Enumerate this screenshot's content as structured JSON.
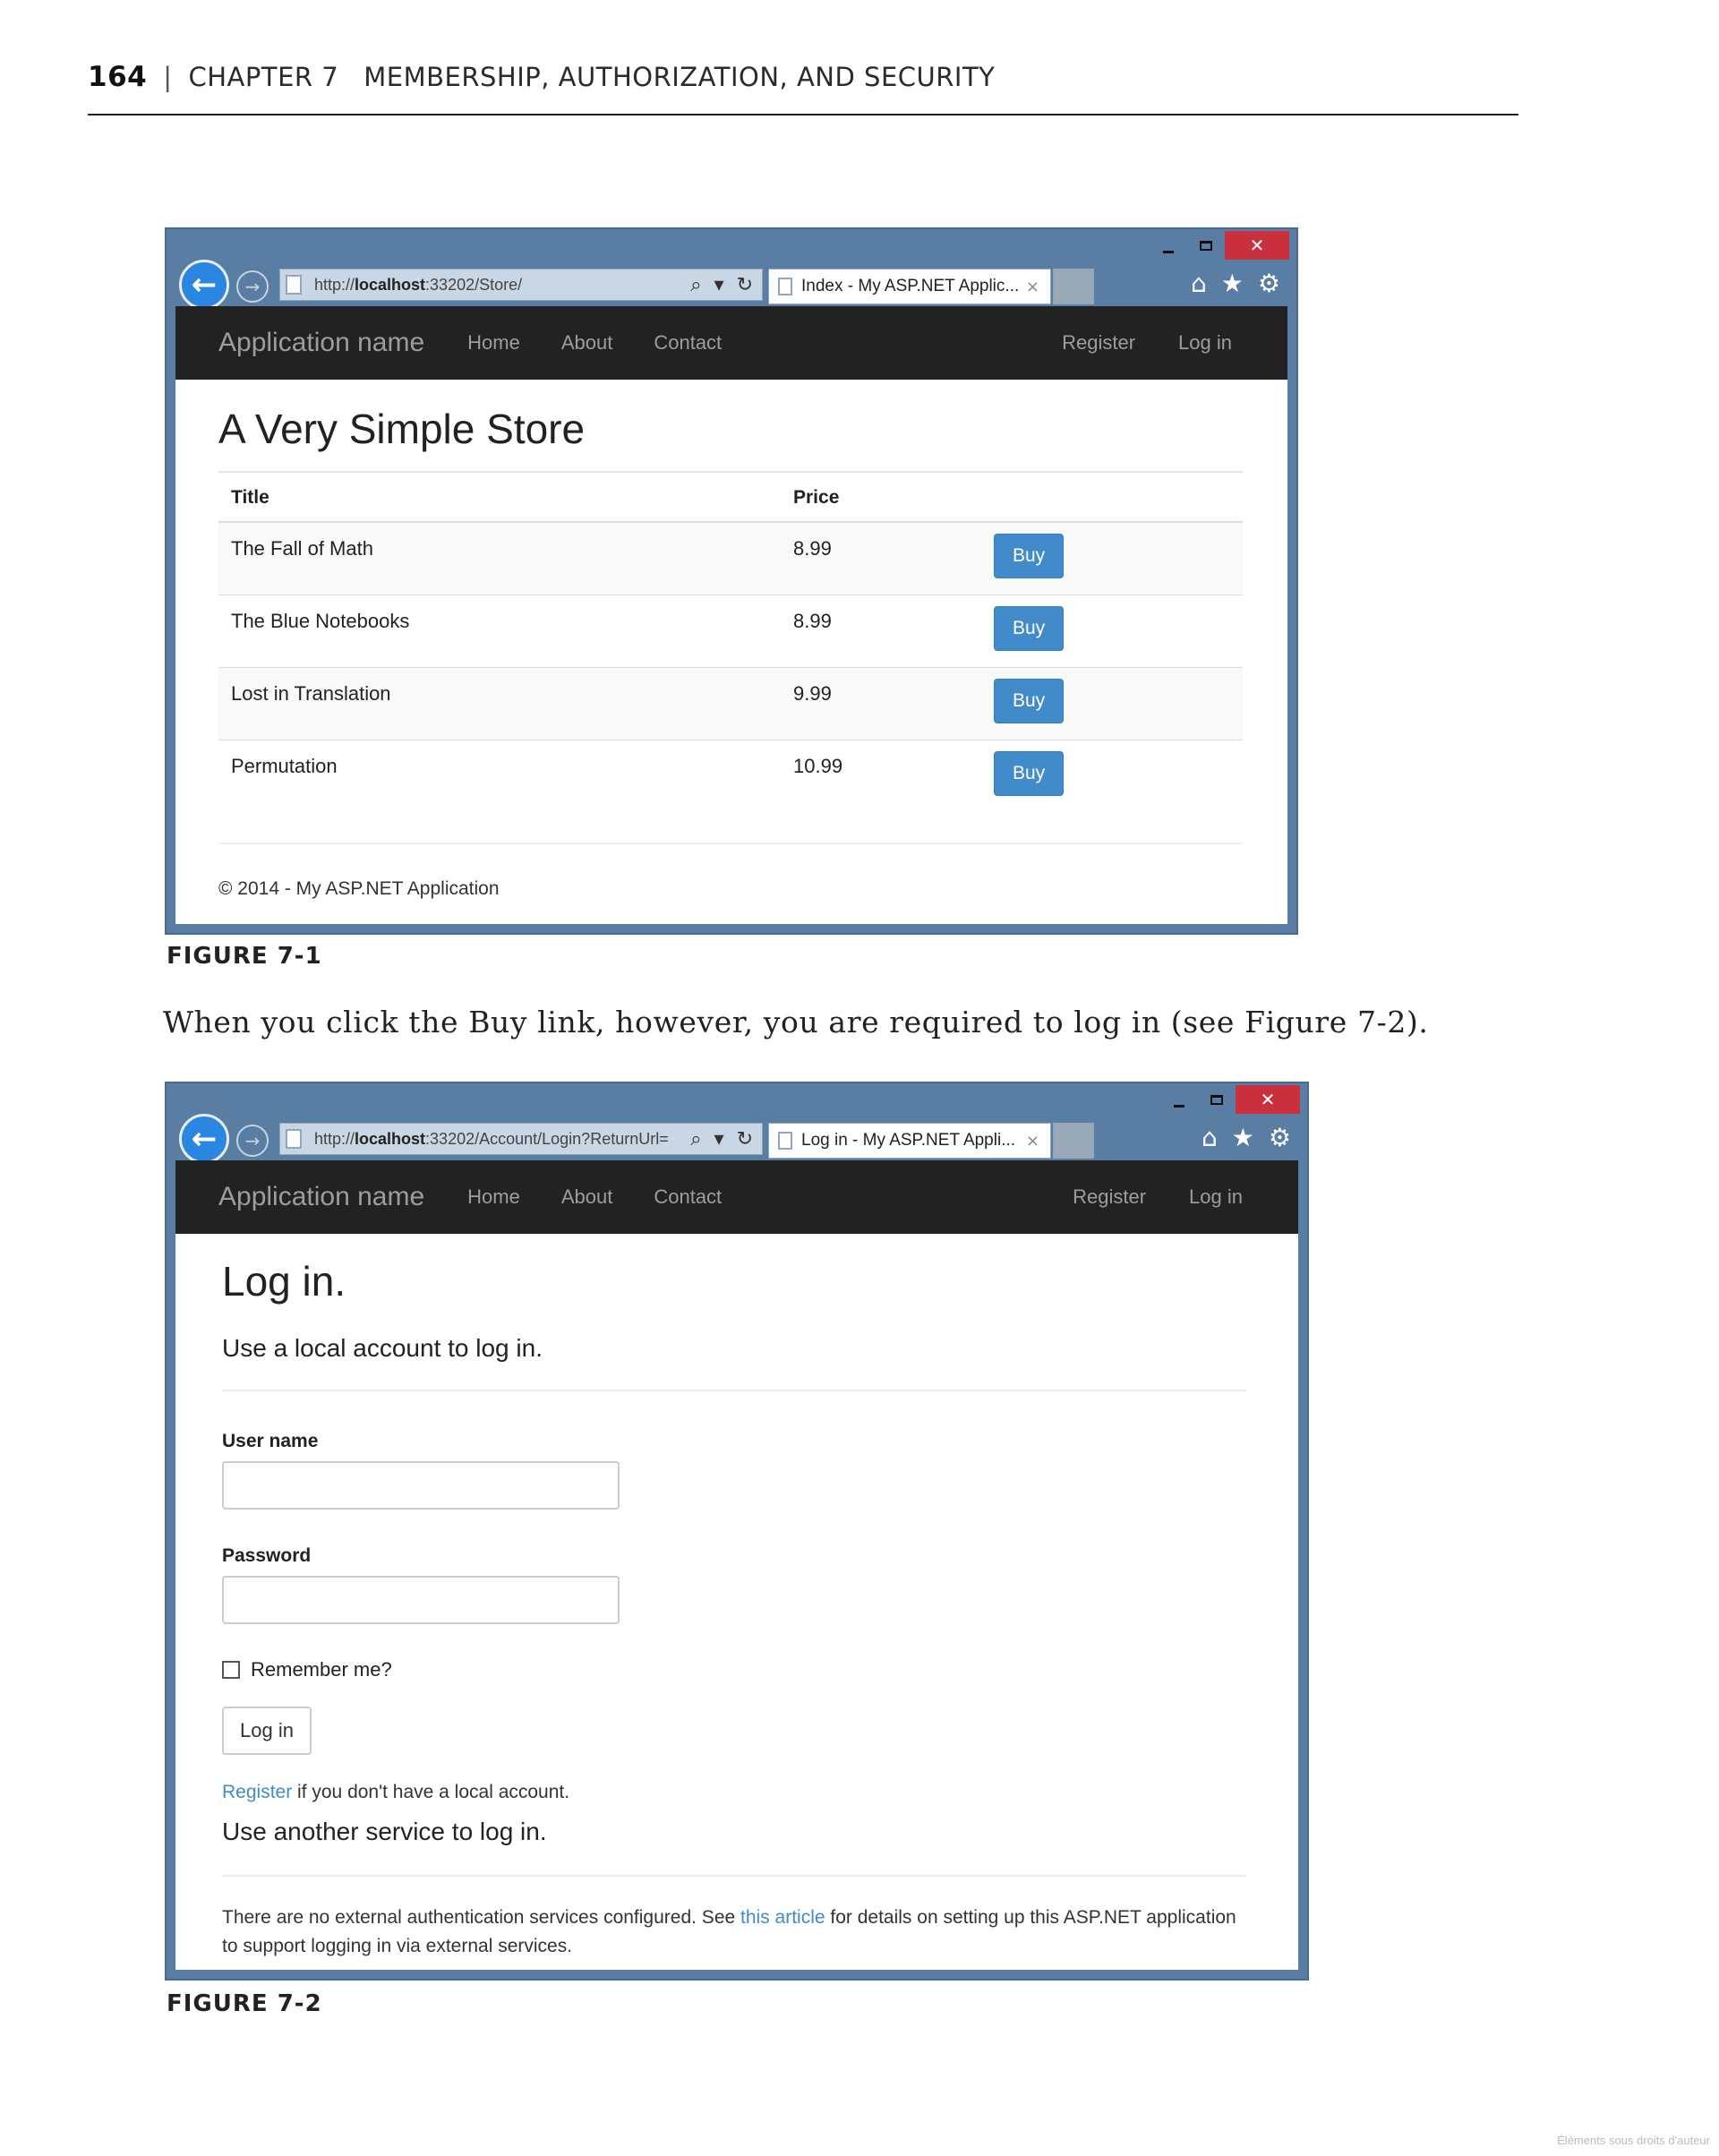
{
  "page_header": {
    "page_number": "164",
    "separator": "|",
    "chapter_label": "CHAPTER 7",
    "chapter_title": "MEMBERSHIP, AUTHORIZATION, AND SECURITY"
  },
  "figure1": {
    "browser": {
      "url_prefix": "http://",
      "url_host": "localhost",
      "url_rest": ":33202/Store/",
      "tab_title": "Index - My ASP.NET Applic...",
      "close_glyph": "×"
    },
    "navbar": {
      "brand": "Application name",
      "links": [
        "Home",
        "About",
        "Contact"
      ],
      "right_links": [
        "Register",
        "Log in"
      ]
    },
    "title": "A Very Simple Store",
    "table": {
      "headers": [
        "Title",
        "Price"
      ],
      "rows": [
        {
          "title": "The Fall of Math",
          "price": "8.99",
          "action": "Buy"
        },
        {
          "title": "The Blue Notebooks",
          "price": "8.99",
          "action": "Buy"
        },
        {
          "title": "Lost in Translation",
          "price": "9.99",
          "action": "Buy"
        },
        {
          "title": "Permutation",
          "price": "10.99",
          "action": "Buy"
        }
      ]
    },
    "footer": "© 2014 - My ASP.NET Application",
    "caption": "FIGURE 7-1"
  },
  "body_text": "When you click the Buy link, however, you are required to log in (see Figure 7-2).",
  "figure2": {
    "browser": {
      "url_prefix": "http://",
      "url_host": "localhost",
      "url_rest": ":33202/Account/Login?ReturnUrl=",
      "tab_title": "Log in - My ASP.NET Appli...",
      "close_glyph": "×"
    },
    "navbar": {
      "brand": "Application name",
      "links": [
        "Home",
        "About",
        "Contact"
      ],
      "right_links": [
        "Register",
        "Log in"
      ]
    },
    "title": "Log in.",
    "subtitle": "Use a local account to log in.",
    "username_label": "User name",
    "username_value": "",
    "password_label": "Password",
    "password_value": "",
    "remember_label": "Remember me?",
    "login_button": "Log in",
    "register_link": "Register",
    "register_suffix": " if you don't have a local account.",
    "other_service_heading": "Use another service to log in.",
    "ext_note_before": "There are no external authentication services configured. See ",
    "ext_note_link": "this article",
    "ext_note_after": " for details on setting up this ASP.NET application to support logging in via external services.",
    "caption": "FIGURE 7-2"
  },
  "icons": {
    "back": "back-arrow-icon",
    "forward": "forward-arrow-icon",
    "search": "search-icon",
    "refresh": "refresh-icon",
    "home": "home-icon",
    "favorites": "star-icon",
    "settings": "gear-icon"
  },
  "watermark": "Éléments sous droits d'auteur",
  "colors": {
    "window_frame": "#5a7da3",
    "close_button": "#c9303e",
    "navbar_bg": "#222222",
    "buy_button": "#428bca",
    "link": "#428bca"
  }
}
